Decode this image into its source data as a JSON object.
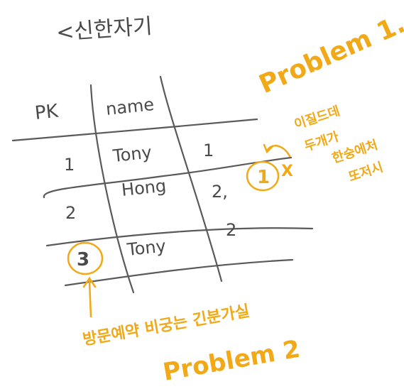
{
  "sketch": {
    "heading": "<신한자기",
    "table": {
      "headers": [
        "PK",
        "name"
      ],
      "rows": [
        {
          "pk": "1",
          "name": "Tony",
          "extra": "1"
        },
        {
          "pk": "",
          "name": "Hong",
          "extra": "2,"
        },
        {
          "pk": "2",
          "name": "",
          "extra": ""
        },
        {
          "pk": "3",
          "name": "Tony",
          "extra": "2"
        }
      ]
    },
    "annotations": {
      "problem1_title": "Problem 1.",
      "problem1_note_lines": [
        "이질드데",
        "두개가",
        "한숭에처",
        "또저시"
      ],
      "circled_one": "1",
      "cross_mark": "X",
      "circled_three": "3",
      "problem2_note": "방문예약 비궁는 긴분가실",
      "problem2_title": "Problem 2"
    },
    "colors": {
      "ink": "#4a4a4a",
      "highlight": "#f2a917"
    }
  }
}
